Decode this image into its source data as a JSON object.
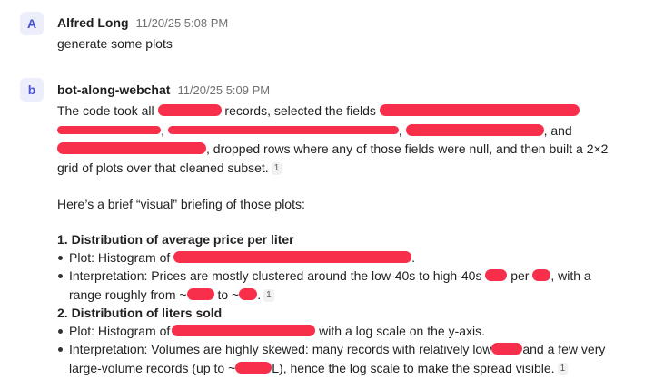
{
  "messages": [
    {
      "avatar_letter": "A",
      "author": "Alfred Long",
      "timestamp": "11/20/25 5:08 PM",
      "text": "generate some plots"
    },
    {
      "avatar_letter": "b",
      "author": "bot-along-webchat",
      "timestamp": "11/20/25 5:09 PM",
      "p1": {
        "t1": "The code took all",
        "t2": "records, selected the fields",
        "t3": ",",
        "t4": ",",
        "t5": ", and",
        "t6": ", dropped rows where any of those fields were null, and then built a 2×2",
        "t7": "grid of plots over that cleaned subset.",
        "cite": "1"
      },
      "p2": "Here’s a brief “visual” briefing of those plots:",
      "section1": {
        "heading": "1. Distribution of average price per liter",
        "plot_prefix": "Plot: Histogram of",
        "plot_suffix": ".",
        "interp_a": "Interpretation: Prices are mostly clustered around the low-40s to high-40s",
        "interp_b": "per",
        "interp_c": ", with a",
        "interp_d": "range roughly from ~",
        "interp_e": "to ~",
        "interp_f": ".",
        "cite": "1"
      },
      "section2": {
        "heading": "2. Distribution of liters sold",
        "plot_prefix": "Plot: Histogram of",
        "plot_suffix": "with a log scale on the y-axis.",
        "interp_a": "Interpretation: Volumes are highly skewed: many records with relatively low",
        "interp_b": "and a few very",
        "interp_c": "large-volume records (up to ~",
        "interp_d": "L), hence the log scale to make the spread visible.",
        "cite": "1"
      }
    }
  ]
}
